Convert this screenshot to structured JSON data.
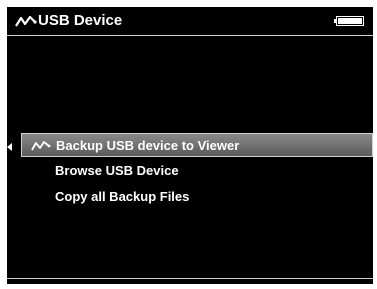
{
  "header": {
    "title": "USB Device",
    "icon": "usb-icon",
    "battery_icon": "battery-icon"
  },
  "menu": {
    "items": [
      {
        "label": "Backup USB device to Viewer",
        "selected": true,
        "icon": "usb-icon"
      },
      {
        "label": "Browse USB Device",
        "selected": false
      },
      {
        "label": "Copy all Backup Files",
        "selected": false
      }
    ]
  },
  "colors": {
    "background": "#000000",
    "text": "#ffffff",
    "selection": "#6f6f6f"
  }
}
